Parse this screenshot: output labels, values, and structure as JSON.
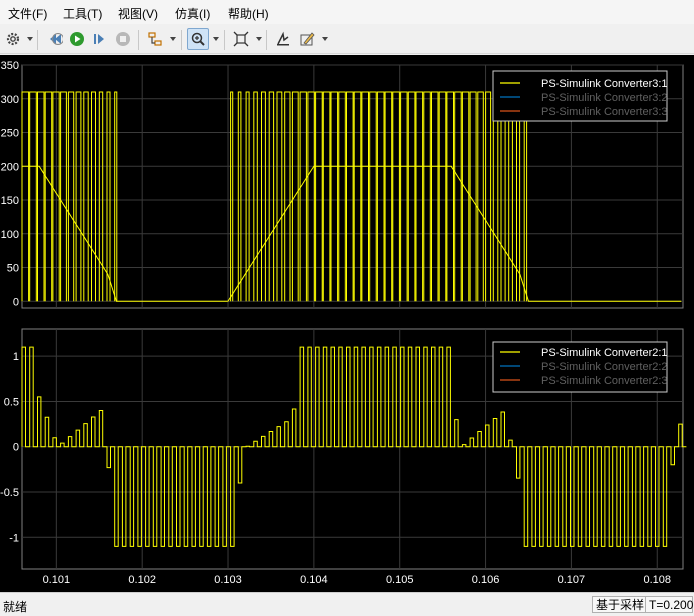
{
  "menu": [
    "文件(F)",
    "工具(T)",
    "视图(V)",
    "仿真(I)",
    "帮助(H)"
  ],
  "toolbar": {
    "icons": [
      "gear-icon",
      "rewind-icon",
      "run-icon",
      "step-forward-icon",
      "stop-icon",
      "highlight-icon",
      "zoom-in-icon",
      "fit-icon",
      "restore-layout-icon",
      "style-icon"
    ]
  },
  "top_plot": {
    "y_ticks": [
      "350",
      "300",
      "250",
      "200",
      "150",
      "100",
      "50",
      "0"
    ],
    "legend": [
      "PS-Simulink Converter3:1",
      "PS-Simulink Converter3:2",
      "PS-Simulink Converter3:3"
    ]
  },
  "bottom_plot": {
    "y_ticks": [
      "1",
      "0.5",
      "0",
      "-0.5",
      "-1"
    ],
    "legend": [
      "PS-Simulink Converter2:1",
      "PS-Simulink Converter2:2",
      "PS-Simulink Converter2:3"
    ]
  },
  "x_ticks": [
    "0.101",
    "0.102",
    "0.103",
    "0.104",
    "0.105",
    "0.106",
    "0.107",
    "0.108"
  ],
  "status": {
    "ready": "就绪",
    "mode": "基于采样",
    "time": "T=0.200"
  },
  "colors": {
    "series1": "#ffff00",
    "series2": "#0072bd",
    "series3": "#d95319",
    "grid": "#3a3a3a",
    "axes_bg": "#000000",
    "axis_line": "#808080"
  },
  "chart_data": [
    {
      "type": "line",
      "x_range": [
        0.1006,
        0.1083
      ],
      "ylim": [
        -10,
        350
      ],
      "y_ticks": [
        0,
        50,
        100,
        150,
        200,
        250,
        300,
        350
      ],
      "x_ticks": [
        0.101,
        0.102,
        0.103,
        0.104,
        0.105,
        0.106,
        0.107,
        0.108
      ],
      "grid": true,
      "legend_position": "top-right",
      "series": [
        {
          "name": "PS-Simulink Converter3:1",
          "kind": "pulse-train",
          "x": [
            0.1006,
            0.1008,
            0.101,
            0.1012,
            0.1014,
            0.1016,
            0.1017,
            0.103,
            0.1032,
            0.1034,
            0.1036,
            0.1038,
            0.104,
            0.1042,
            0.1044,
            0.1046,
            0.1048,
            0.105,
            0.1052,
            0.1054,
            0.1056,
            0.1058,
            0.106,
            0.1062,
            0.1064,
            0.1065,
            0.1082
          ],
          "y": [
            200,
            200,
            160,
            120,
            80,
            40,
            0,
            0,
            40,
            80,
            120,
            160,
            200,
            200,
            200,
            200,
            200,
            200,
            200,
            200,
            200,
            160,
            120,
            80,
            40,
            0,
            0
          ]
        },
        {
          "name": "PS-Simulink Converter3:2",
          "x": [],
          "y": []
        },
        {
          "name": "PS-Simulink Converter3:3",
          "x": [],
          "y": []
        }
      ]
    },
    {
      "type": "line",
      "x_range": [
        0.1006,
        0.1083
      ],
      "ylim": [
        -1.35,
        1.3
      ],
      "y_ticks": [
        -1,
        -0.5,
        0,
        0.5,
        1
      ],
      "x_ticks": [
        0.101,
        0.102,
        0.103,
        0.104,
        0.105,
        0.106,
        0.107,
        0.108
      ],
      "grid": true,
      "legend_position": "top-right",
      "series": [
        {
          "name": "PS-Simulink Converter2:1",
          "kind": "bipolar-pulse-train",
          "x": [
            0.1006,
            0.101,
            0.1015,
            0.1017,
            0.102,
            0.1025,
            0.103,
            0.1032,
            0.1037,
            0.104,
            0.1045,
            0.105,
            0.1055,
            0.1057,
            0.1062,
            0.1065,
            0.107,
            0.1075,
            0.108,
            0.1083
          ],
          "y": [
            1,
            0,
            0.4,
            -1,
            -1,
            -1,
            -1,
            0,
            0.3,
            1,
            1,
            1,
            1,
            0,
            0.4,
            -1,
            -1,
            -1,
            -1,
            0.5
          ]
        },
        {
          "name": "PS-Simulink Converter2:2",
          "x": [],
          "y": []
        },
        {
          "name": "PS-Simulink Converter2:3",
          "x": [],
          "y": []
        }
      ]
    }
  ]
}
